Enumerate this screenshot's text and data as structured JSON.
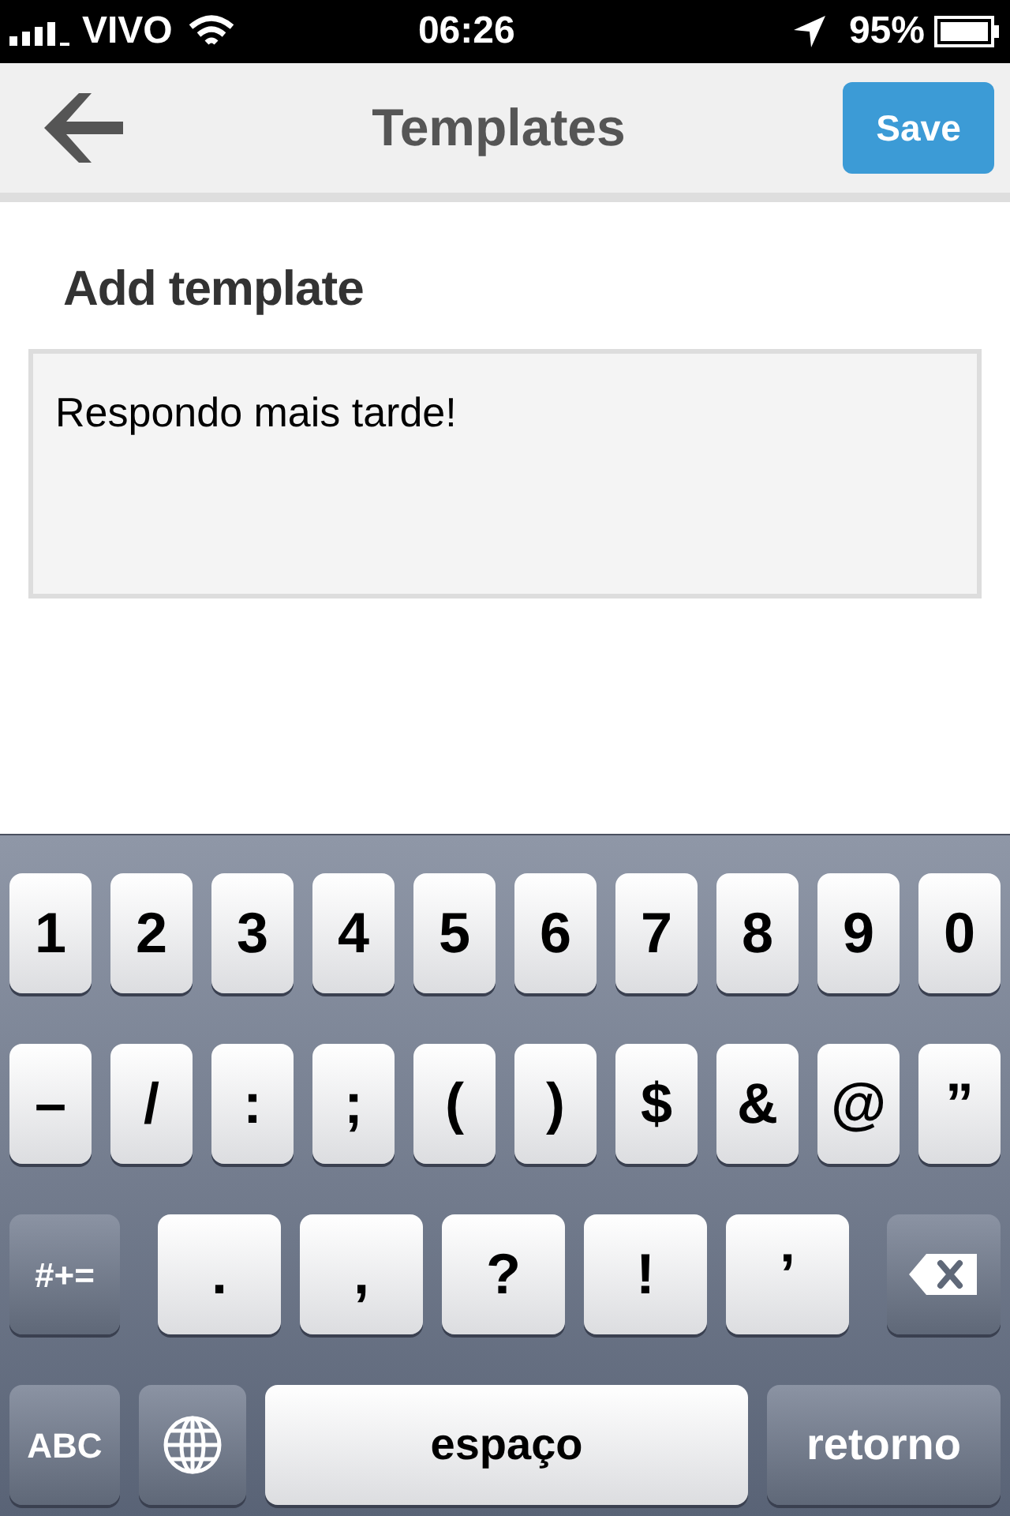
{
  "status_bar": {
    "carrier": "VIVO",
    "time": "06:26",
    "battery": "95%"
  },
  "nav": {
    "title": "Templates",
    "save_button": "Save"
  },
  "form": {
    "heading": "Add template",
    "value": "Respondo mais tarde!"
  },
  "keyboard": {
    "number_keys": [
      {
        "kind": "char",
        "label": "1"
      },
      {
        "kind": "char",
        "label": "2"
      },
      {
        "kind": "char",
        "label": "3"
      },
      {
        "kind": "char",
        "label": "4"
      },
      {
        "kind": "char",
        "label": "5"
      },
      {
        "kind": "char",
        "label": "6"
      },
      {
        "kind": "char",
        "label": "7"
      },
      {
        "kind": "char",
        "label": "8"
      },
      {
        "kind": "char",
        "label": "9"
      },
      {
        "kind": "char",
        "label": "0"
      }
    ],
    "symbol_keys": [
      {
        "kind": "char",
        "label": "–"
      },
      {
        "kind": "char",
        "label": "/"
      },
      {
        "kind": "char",
        "label": ":"
      },
      {
        "kind": "char",
        "label": ";"
      },
      {
        "kind": "char",
        "label": "("
      },
      {
        "kind": "char",
        "label": ")"
      },
      {
        "kind": "char",
        "label": "$"
      },
      {
        "kind": "char",
        "label": "&"
      },
      {
        "kind": "char",
        "label": "@"
      },
      {
        "kind": "char",
        "label": "”"
      }
    ],
    "punctuation_keys": [
      {
        "kind": "modifier",
        "label": "#+="
      },
      {
        "kind": "wide",
        "label": "."
      },
      {
        "kind": "wide",
        "label": ","
      },
      {
        "kind": "wide",
        "label": "?"
      },
      {
        "kind": "wide",
        "label": "!"
      },
      {
        "kind": "wide",
        "label": "’"
      },
      {
        "kind": "delete"
      }
    ],
    "bottom_keys": [
      {
        "kind": "modifier",
        "label": "ABC"
      },
      {
        "kind": "globe"
      },
      {
        "kind": "space",
        "label": "espaço"
      },
      {
        "kind": "return",
        "label": "retorno"
      }
    ]
  }
}
